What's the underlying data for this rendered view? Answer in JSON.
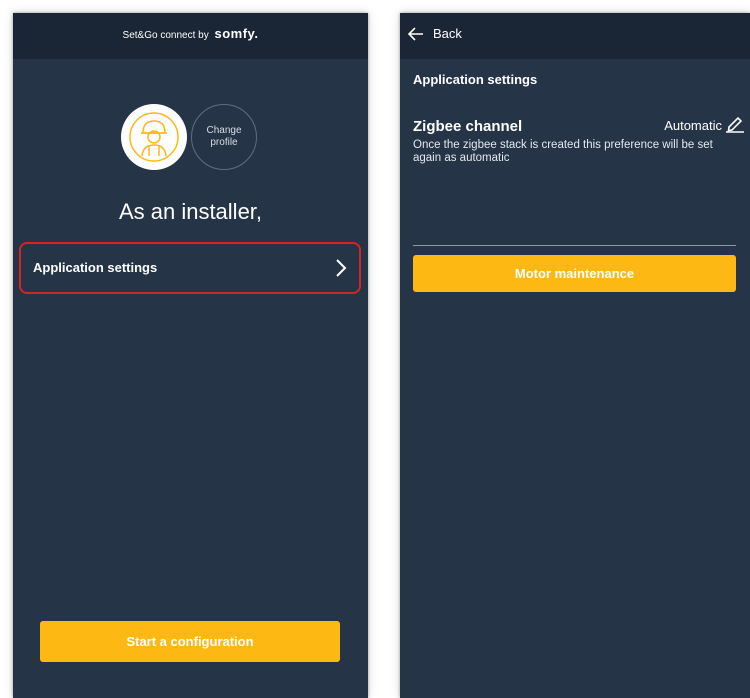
{
  "left": {
    "brand_text": "Set&Go connect by",
    "brand_logo": "somfy.",
    "change_profile": "Change profile",
    "headline": "As an installer,",
    "settings_label": "Application settings",
    "start_button": "Start a configuration"
  },
  "right": {
    "back_label": "Back",
    "section_title": "Application settings",
    "zigbee_title": "Zigbee channel",
    "zigbee_value": "Automatic",
    "zigbee_desc": "Once the zigbee stack is created this preference will be set again as automatic",
    "motor_button": "Motor maintenance"
  },
  "colors": {
    "background": "#253447",
    "topbar": "#1a2535",
    "accent": "#fdb813",
    "highlight": "#d42525"
  },
  "icons": [
    "installer-avatar-icon",
    "chevron-right-icon",
    "arrow-left-icon",
    "pencil-icon"
  ]
}
